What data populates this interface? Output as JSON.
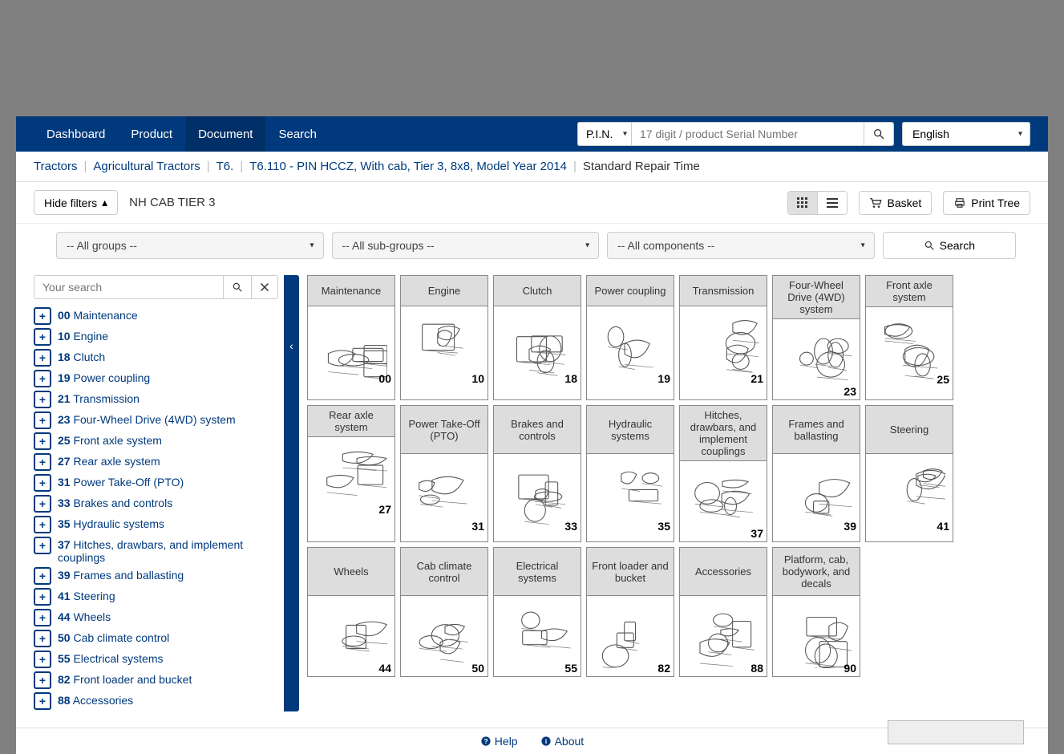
{
  "nav": {
    "items": [
      "Dashboard",
      "Product",
      "Document",
      "Search"
    ],
    "active_index": 2,
    "pin_label": "P.I.N.",
    "pin_placeholder": "17 digit / product Serial Number",
    "language": "English"
  },
  "breadcrumb": {
    "items": [
      "Tractors",
      "Agricultural Tractors",
      "T6.",
      "T6.110 - PIN HCCZ, With cab, Tier 3, 8x8, Model Year 2014"
    ],
    "current": "Standard Repair Time"
  },
  "toolbar": {
    "hide_filters": "Hide filters",
    "context_label": "NH CAB TIER 3",
    "basket": "Basket",
    "print_tree": "Print Tree"
  },
  "filters": {
    "groups": "-- All groups --",
    "subgroups": "-- All sub-groups --",
    "components": "-- All components --",
    "search": "Search"
  },
  "sidebar": {
    "search_placeholder": "Your search",
    "tree": [
      {
        "code": "00",
        "label": "Maintenance"
      },
      {
        "code": "10",
        "label": "Engine"
      },
      {
        "code": "18",
        "label": "Clutch"
      },
      {
        "code": "19",
        "label": "Power coupling"
      },
      {
        "code": "21",
        "label": "Transmission"
      },
      {
        "code": "23",
        "label": "Four-Wheel Drive (4WD) system"
      },
      {
        "code": "25",
        "label": "Front axle system"
      },
      {
        "code": "27",
        "label": "Rear axle system"
      },
      {
        "code": "31",
        "label": "Power Take-Off (PTO)"
      },
      {
        "code": "33",
        "label": "Brakes and controls"
      },
      {
        "code": "35",
        "label": "Hydraulic systems"
      },
      {
        "code": "37",
        "label": "Hitches, drawbars, and implement couplings"
      },
      {
        "code": "39",
        "label": "Frames and ballasting"
      },
      {
        "code": "41",
        "label": "Steering"
      },
      {
        "code": "44",
        "label": "Wheels"
      },
      {
        "code": "50",
        "label": "Cab climate control"
      },
      {
        "code": "55",
        "label": "Electrical systems"
      },
      {
        "code": "82",
        "label": "Front loader and bucket"
      },
      {
        "code": "88",
        "label": "Accessories"
      }
    ]
  },
  "grid": [
    {
      "title": "Maintenance",
      "num": "00",
      "tall": false
    },
    {
      "title": "Engine",
      "num": "10",
      "tall": false
    },
    {
      "title": "Clutch",
      "num": "18",
      "tall": false
    },
    {
      "title": "Power coupling",
      "num": "19",
      "tall": false
    },
    {
      "title": "Transmission",
      "num": "21",
      "tall": false
    },
    {
      "title": "Four-Wheel Drive (4WD) system",
      "num": "23",
      "tall": false
    },
    {
      "title": "Front axle system",
      "num": "25",
      "tall": false
    },
    {
      "title": "Rear axle system",
      "num": "27",
      "tall": false
    },
    {
      "title": "Power Take-Off (PTO)",
      "num": "31",
      "tall": true
    },
    {
      "title": "Brakes and controls",
      "num": "33",
      "tall": true
    },
    {
      "title": "Hydraulic systems",
      "num": "35",
      "tall": true
    },
    {
      "title": "Hitches, drawbars, and implement couplings",
      "num": "37",
      "tall": true
    },
    {
      "title": "Frames and ballasting",
      "num": "39",
      "tall": true
    },
    {
      "title": "Steering",
      "num": "41",
      "tall": true
    },
    {
      "title": "Wheels",
      "num": "44",
      "tall": true
    },
    {
      "title": "Cab climate control",
      "num": "50",
      "tall": true
    },
    {
      "title": "Electrical systems",
      "num": "55",
      "tall": true
    },
    {
      "title": "Front loader and bucket",
      "num": "82",
      "tall": true
    },
    {
      "title": "Accessories",
      "num": "88",
      "tall": true
    },
    {
      "title": "Platform, cab, bodywork, and decals",
      "num": "90",
      "tall": true
    }
  ],
  "footer": {
    "help": "Help",
    "about": "About"
  }
}
